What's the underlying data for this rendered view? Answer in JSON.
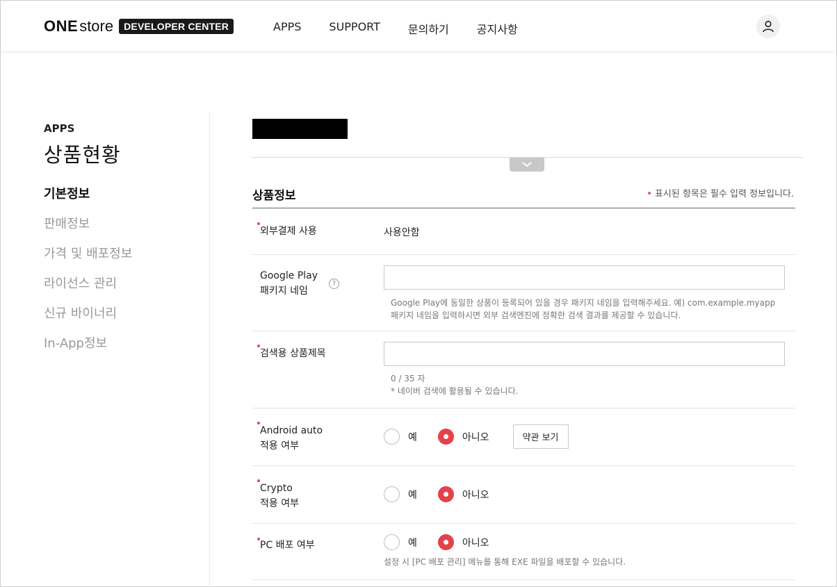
{
  "header": {
    "logo_one": "ONE",
    "logo_store": "store",
    "logo_badge": "DEVELOPER CENTER",
    "nav": [
      "APPS",
      "SUPPORT",
      "문의하기",
      "공지사항"
    ],
    "avatar_icon": "user-icon"
  },
  "sidebar": {
    "section": "APPS",
    "title": "상품현황",
    "items": [
      {
        "label": "기본정보",
        "active": true
      },
      {
        "label": "판매정보",
        "active": false
      },
      {
        "label": "가격 및 배포정보",
        "active": false
      },
      {
        "label": "라이선스 관리",
        "active": false
      },
      {
        "label": "신규 바이너리",
        "active": false
      },
      {
        "label": "In-App정보",
        "active": false
      }
    ]
  },
  "main": {
    "section_title": "상품정보",
    "required_note": "표시된 항목은 필수 입력 정보입니다.",
    "required_dot": "•",
    "external_payment": {
      "label": "외부결제 사용",
      "value": "사용안함"
    },
    "google_play": {
      "label_line1": "Google Play",
      "label_line2": "패키지 네임",
      "help_icon": "?",
      "value": "",
      "help_line1": "Google Play에 동일한 상품이 등록되어 있을 경우 패키지 네임을 입력해주세요. 예) com.example.myapp",
      "help_line2": "패키지 네임을 입력하시면 외부 검색엔진에 정확한 검색 결과를 제공할 수 있습니다."
    },
    "search_title": {
      "label": "검색용 상품제목",
      "value": "",
      "count": "0 / 35 자",
      "help": "* 네이버 검색에 활용될 수 있습니다."
    },
    "android_auto": {
      "label_line1": "Android auto",
      "label_line2": "적용 여부",
      "yes": "예",
      "no": "아니오",
      "selected": "no",
      "terms_button": "약관 보기"
    },
    "crypto": {
      "label_line1": "Crypto",
      "label_line2": "적용 여부",
      "yes": "예",
      "no": "아니오",
      "selected": "no"
    },
    "pc_deploy": {
      "label": "PC 배포 여부",
      "yes": "예",
      "no": "아니오",
      "selected": "no",
      "help": "설정 시 [PC 배포 관리] 메뉴를 통해 EXE 파일을 배포할 수 있습니다."
    }
  },
  "colors": {
    "accent": "#e5414b",
    "required": "#e04a4a"
  }
}
